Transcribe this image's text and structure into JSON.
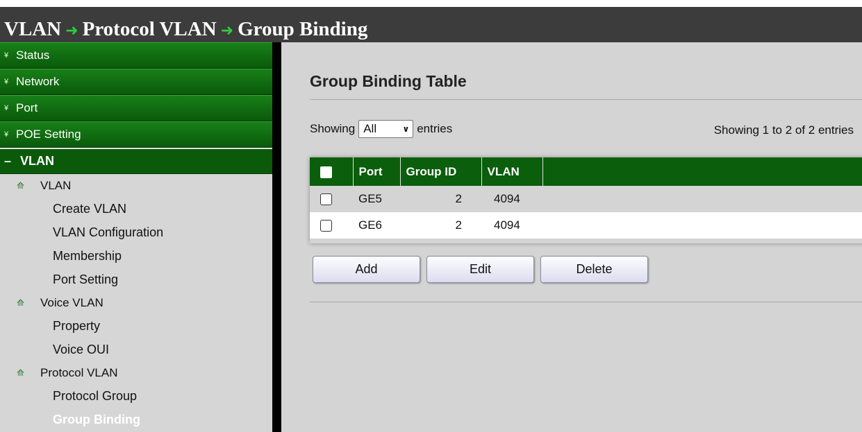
{
  "breadcrumb": [
    "VLAN",
    "Protocol VLAN",
    "Group Binding"
  ],
  "sidebar": {
    "categories": [
      {
        "label": "Status"
      },
      {
        "label": "Network"
      },
      {
        "label": "Port"
      },
      {
        "label": "POE Setting"
      }
    ],
    "open_category": {
      "label": "VLAN"
    },
    "groups": [
      {
        "label": "VLAN",
        "items": [
          "Create VLAN",
          "VLAN Configuration",
          "Membership",
          "Port Setting"
        ]
      },
      {
        "label": "Voice VLAN",
        "items": [
          "Property",
          "Voice OUI"
        ]
      },
      {
        "label": "Protocol VLAN",
        "items": [
          "Protocol Group",
          "Group Binding"
        ]
      }
    ],
    "active_item": "Group Binding"
  },
  "main": {
    "title": "Group Binding Table",
    "showing_prefix": "Showing",
    "entries_select": "All",
    "entries_suffix": "entries",
    "showing_summary": "Showing 1 to 2 of 2 entries",
    "table": {
      "headers": [
        "Port",
        "Group ID",
        "VLAN"
      ],
      "rows": [
        {
          "port": "GE5",
          "group_id": "2",
          "vlan": "4094"
        },
        {
          "port": "GE6",
          "group_id": "2",
          "vlan": "4094"
        }
      ]
    },
    "buttons": {
      "add": "Add",
      "edit": "Edit",
      "delete": "Delete"
    }
  },
  "colors": {
    "menu_green": "#0a5a0a",
    "header_green": "#0b5e0b",
    "panel_gray": "#d4d4d4"
  }
}
